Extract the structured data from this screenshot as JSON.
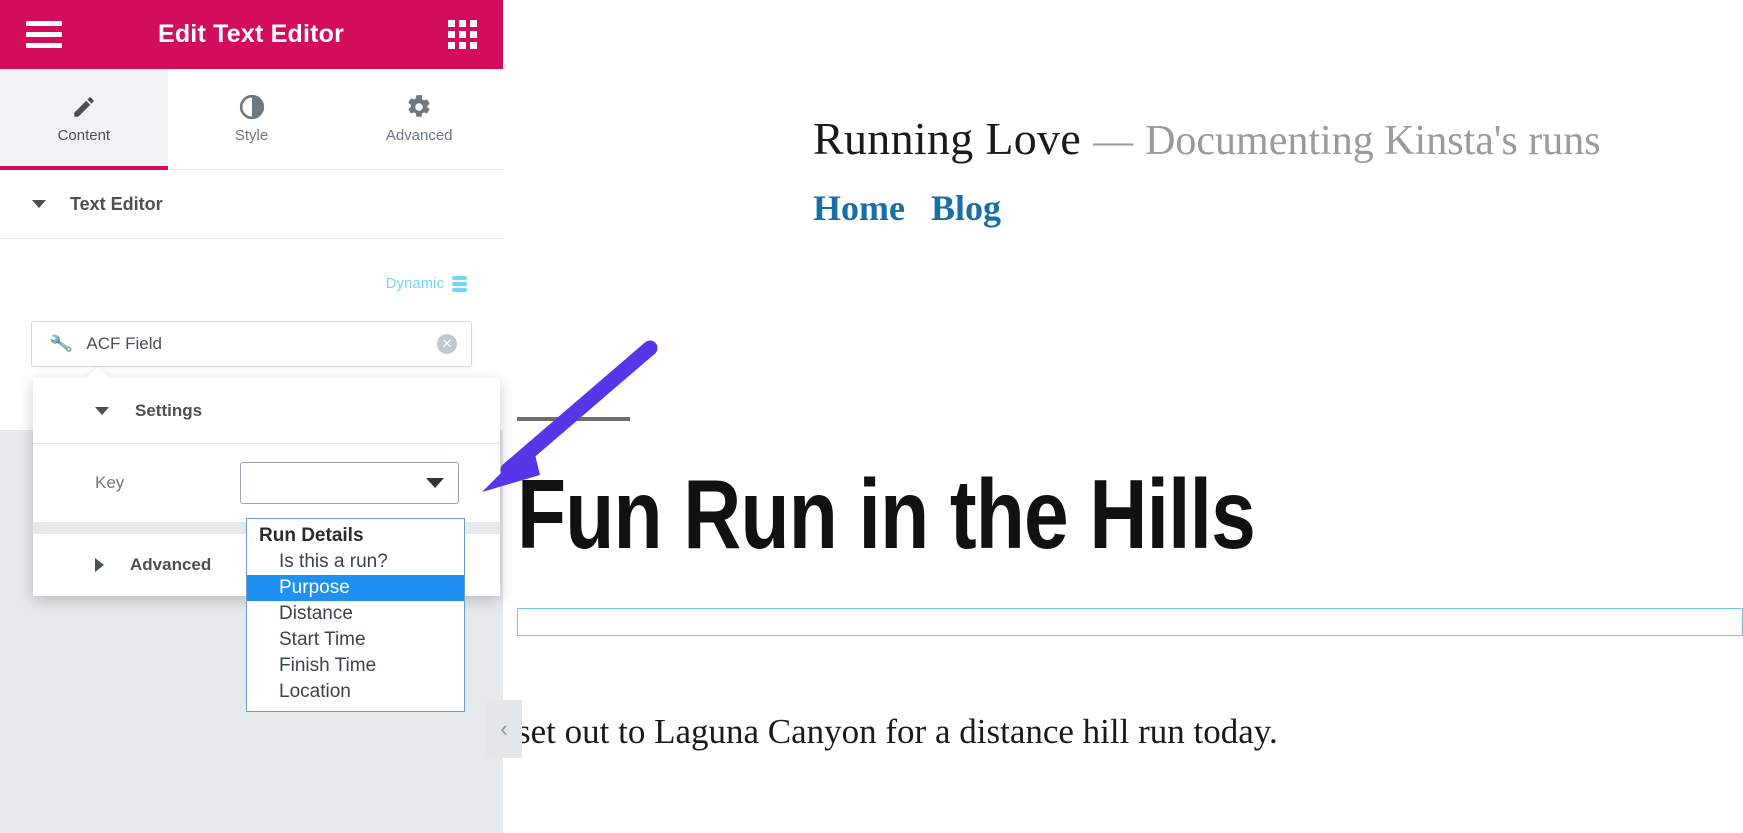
{
  "panel": {
    "header": {
      "title": "Edit Text Editor",
      "menu_icon": "hamburger-menu-icon",
      "apps_icon": "grid-apps-icon"
    },
    "tabs": [
      {
        "label": "Content",
        "icon": "pencil-icon",
        "active": true
      },
      {
        "label": "Style",
        "icon": "contrast-circle-icon",
        "active": false
      },
      {
        "label": "Advanced",
        "icon": "gear-icon",
        "active": false
      }
    ],
    "section": {
      "title": "Text Editor",
      "caret_icon": "caret-down-icon"
    },
    "dynamic": {
      "label": "Dynamic",
      "icon": "database-stack-icon"
    },
    "acf_field": {
      "name": "ACF Field",
      "wrench_icon": "wrench-icon",
      "clear_icon": "clear-circle-x-icon"
    },
    "popover": {
      "settings_title": "Settings",
      "settings_caret_icon": "caret-down-icon",
      "key_label": "Key",
      "key_value": "",
      "select_caret_icon": "caret-down-icon",
      "advanced_title": "Advanced",
      "advanced_caret_icon": "caret-right-icon"
    },
    "dropdown": {
      "group_label": "Run Details",
      "selected": "Purpose",
      "options": [
        "Is this a run?",
        "Purpose",
        "Distance",
        "Start Time",
        "Finish Time",
        "Location"
      ]
    },
    "collapse_handle_icon": "chevron-left-icon"
  },
  "preview": {
    "site_title": "Running Love",
    "site_dash": "—",
    "site_tagline": "Documenting Kinsta's runs",
    "nav": [
      {
        "label": "Home"
      },
      {
        "label": "Blog"
      }
    ],
    "post_title": "Fun Run in the Hills",
    "post_body": "set out to Laguna Canyon for a distance hill run today.",
    "empty_widget_placeholder": ""
  },
  "annotation": {
    "arrow_color": "#5636e8",
    "arrow_name": "purple-pointer-arrow"
  },
  "colors": {
    "panel_accent": "#d30c5c",
    "dynamic_blue": "#71d7f7",
    "option_highlight": "#1e90f2",
    "link_blue": "#1a6ea8",
    "widget_outline": "#6ec8e8"
  }
}
